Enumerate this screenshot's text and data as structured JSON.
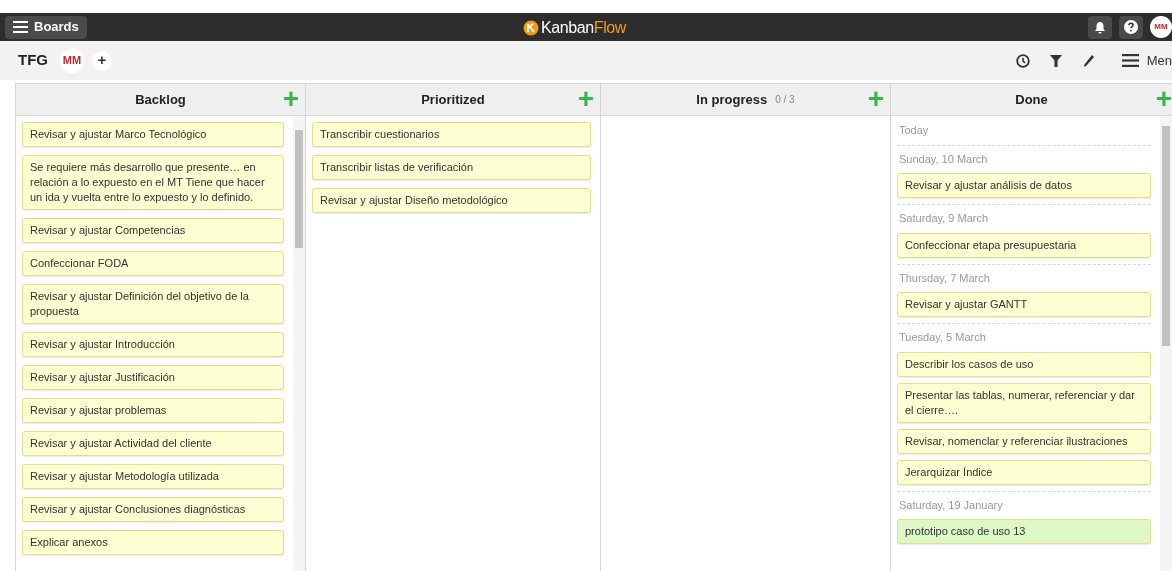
{
  "topbar": {
    "boards_button": "Boards",
    "logo": {
      "part_1": "Kanban",
      "part_2": "Flow"
    },
    "avatar": "MM"
  },
  "board": {
    "title": "TFG",
    "member": "MM",
    "add": "+",
    "menu": "Men"
  },
  "columns": [
    {
      "name": "Backlog",
      "add": "+",
      "scrollbar": true,
      "cards": [
        {
          "text": "Revisar y ajustar Marco Tecnológico",
          "color": "#ffffd4"
        },
        {
          "text": "Se requiere más desarrollo que presente… en relación a lo expuesto en el MT Tiene que hacer un ida y vuelta entre lo expuesto y lo definido.",
          "color": "#ffffd4"
        },
        {
          "text": "Revisar y ajustar Competencias",
          "color": "#ffffd4"
        },
        {
          "text": "Confeccionar FODA",
          "color": "#ffffd4"
        },
        {
          "text": "Revisar y ajustar Definición del objetivo de la propuesta",
          "color": "#ffffd4"
        },
        {
          "text": "Revisar y ajustar Introducción",
          "color": "#ffffd4"
        },
        {
          "text": "Revisar y ajustar Justificación",
          "color": "#ffffd4"
        },
        {
          "text": "Revisar y ajustar problemas",
          "color": "#ffffd4"
        },
        {
          "text": "Revisar y ajustar Actividad del cliente",
          "color": "#ffffd4"
        },
        {
          "text": "Revisar y ajustar Metodología utilizada",
          "color": "#ffffd4"
        },
        {
          "text": "Revisar y ajustar Conclusiones diagnósticas",
          "color": "#ffffd4"
        },
        {
          "text": "Explicar anexos",
          "color": "#ffffd4"
        }
      ]
    },
    {
      "name": "Prioritized",
      "add": "+",
      "scrollbar": false,
      "cards": [
        {
          "text": "Transcribir cuestionarios",
          "color": "#ffffd4"
        },
        {
          "text": "Transcribir listas de verificación",
          "color": "#ffffd4"
        },
        {
          "text": "Revisar y ajustar Diseño metodológico",
          "color": "#ffffd4"
        }
      ]
    },
    {
      "name": "In progress",
      "count": "0 / 3",
      "add": "+",
      "scrollbar": false
    },
    {
      "name": "Done",
      "add": "+",
      "scrollbar": true,
      "groups": [
        {
          "date": "Today"
        },
        {
          "date": "Sunday, 10 March",
          "cards": [
            {
              "text": "Revisar y ajustar análisis de datos",
              "color": "#ffffd4"
            }
          ]
        },
        {
          "date": "Saturday, 9 March",
          "cards": [
            {
              "text": "Confeccionar etapa presupuestaria",
              "color": "#ffffd4"
            }
          ]
        },
        {
          "date": "Thursday, 7 March",
          "cards": [
            {
              "text": "Revisar y ajustar GANTT",
              "color": "#ffffd4"
            }
          ]
        },
        {
          "date": "Tuesday, 5 March",
          "cards": [
            {
              "text": "Describir los casos de uso",
              "color": "#ffffd4"
            },
            {
              "text": "Presentar las tablas, numerar, referenciar y dar el cierre….",
              "color": "#ffffd4"
            },
            {
              "text": "Revisar, nomenclar y referenciar ilustraciones",
              "color": "#ffffd4"
            },
            {
              "text": "Jerarquizar Índice",
              "color": "#ffffd4"
            }
          ]
        },
        {
          "date": "Saturday, 19 January",
          "cards": [
            {
              "text": "prototipo caso de uso 13",
              "color": "#dcf8c6"
            }
          ]
        }
      ]
    }
  ]
}
